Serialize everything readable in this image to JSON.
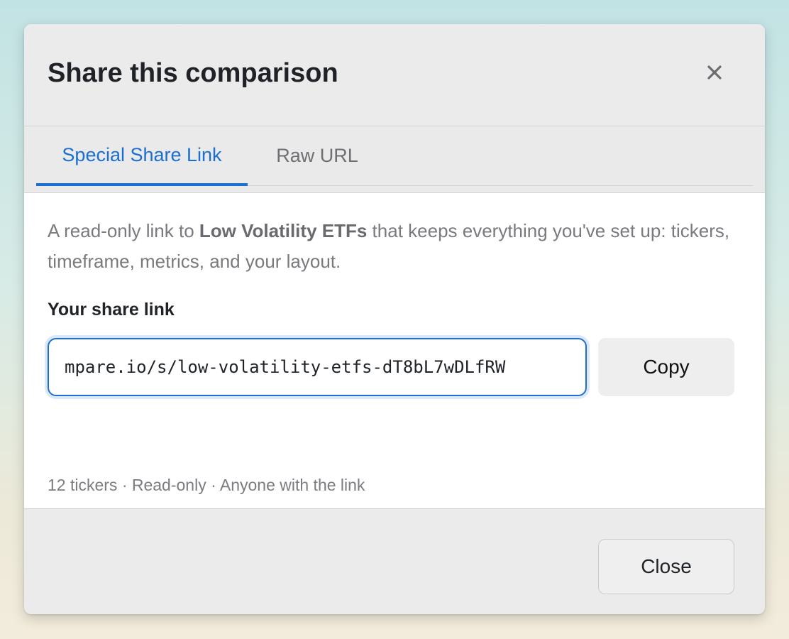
{
  "dialog": {
    "title": "Share this comparison",
    "close_icon": "close-icon"
  },
  "tabs": [
    {
      "label": "Special Share Link",
      "active": true
    },
    {
      "label": "Raw URL",
      "active": false
    }
  ],
  "description": {
    "prefix": "A read-only link to ",
    "comparison_name": "Low Volatility ETFs",
    "suffix": " that keeps everything you've set up: tickers, timeframe, metrics, and your layout."
  },
  "share_link": {
    "label": "Your share link",
    "value": "mpare.io/s/low-volatility-etfs-dT8bL7wDLfRW",
    "copy_label": "Copy"
  },
  "meta": "12 tickers · Read-only · Anyone with the link",
  "footer": {
    "close_label": "Close"
  },
  "colors": {
    "accent": "#1a6fd0",
    "header_bg": "#ebebec",
    "text_muted": "#7a7a7e"
  }
}
